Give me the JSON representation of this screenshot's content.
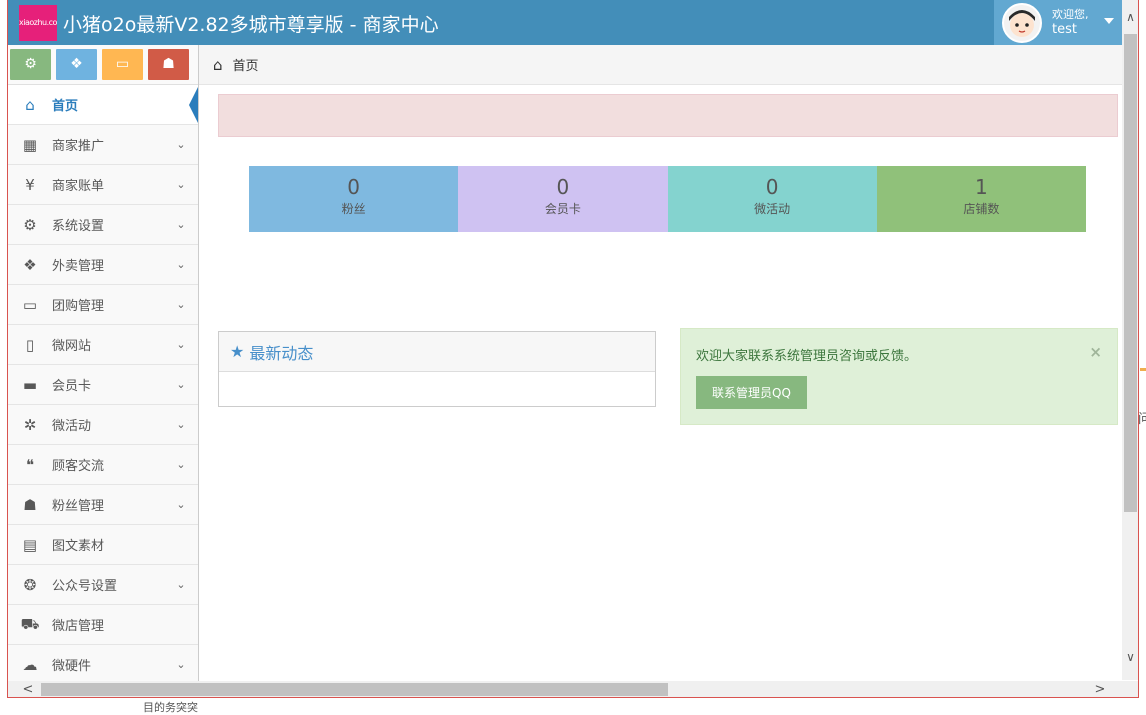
{
  "header": {
    "logo_text": "xiaozhu.com",
    "brand": "小猪o2o最新V2.82多城市尊享版 - 商家中心",
    "welcome": "欢迎您,",
    "username": "test"
  },
  "shortcuts": [
    {
      "icon": "gear-icon",
      "glyph": "⚙",
      "color": "#87b87f"
    },
    {
      "icon": "cubes-icon",
      "glyph": "❖",
      "color": "#6fb3e0"
    },
    {
      "icon": "desktop-icon",
      "glyph": "▭",
      "color": "#ffb752"
    },
    {
      "icon": "users-icon",
      "glyph": "☗",
      "color": "#d15b47"
    }
  ],
  "sidebar": {
    "items": [
      {
        "label": "首页",
        "icon": "home-icon",
        "glyph": "⌂",
        "caret": "",
        "active": true
      },
      {
        "label": "商家推广",
        "icon": "qrcode-icon",
        "glyph": "▦",
        "caret": "⌄"
      },
      {
        "label": "商家账单",
        "icon": "yen-icon",
        "glyph": "¥",
        "caret": "⌄"
      },
      {
        "label": "系统设置",
        "icon": "gear-icon",
        "glyph": "⚙",
        "caret": "⌄"
      },
      {
        "label": "外卖管理",
        "icon": "cubes-icon",
        "glyph": "❖",
        "caret": "⌄"
      },
      {
        "label": "团购管理",
        "icon": "desktop-icon",
        "glyph": "▭",
        "caret": "⌄"
      },
      {
        "label": "微网站",
        "icon": "mobile-icon",
        "glyph": "▯",
        "caret": "⌄"
      },
      {
        "label": "会员卡",
        "icon": "credit-card-icon",
        "glyph": "▬",
        "caret": "⌄"
      },
      {
        "label": "微活动",
        "icon": "life-ring-icon",
        "glyph": "✲",
        "caret": "⌄"
      },
      {
        "label": "顾客交流",
        "icon": "comments-icon",
        "glyph": "❝",
        "caret": "⌄"
      },
      {
        "label": "粉丝管理",
        "icon": "users-icon",
        "glyph": "☗",
        "caret": "⌄"
      },
      {
        "label": "图文素材",
        "icon": "file-excel-icon",
        "glyph": "▤",
        "caret": ""
      },
      {
        "label": "公众号设置",
        "icon": "wechat-icon",
        "glyph": "❂",
        "caret": "⌄"
      },
      {
        "label": "微店管理",
        "icon": "shopping-cart-icon",
        "glyph": "⛟",
        "caret": ""
      },
      {
        "label": "微硬件",
        "icon": "cloud-icon",
        "glyph": "☁",
        "caret": "⌄"
      }
    ]
  },
  "breadcrumb": {
    "home_glyph": "⌂",
    "label": "首页"
  },
  "stats": [
    {
      "value": "0",
      "label": "粉丝",
      "color": "#7fb9e0"
    },
    {
      "value": "0",
      "label": "会员卡",
      "color": "#cfc2f2"
    },
    {
      "value": "0",
      "label": "微活动",
      "color": "#84d3cf"
    },
    {
      "value": "1",
      "label": "店铺数",
      "color": "#90c17a"
    }
  ],
  "news": {
    "star_glyph": "★",
    "title": "最新动态"
  },
  "notice": {
    "text": "欢迎大家联系系统管理员咨询或反馈。",
    "close_glyph": "×",
    "button_label": "联系管理员QQ"
  },
  "scrollbars": {
    "up": "∧",
    "down": "∨",
    "left": "<",
    "right": ">"
  },
  "outside": {
    "bottom_text": "目的务突突",
    "right_text": "问"
  }
}
